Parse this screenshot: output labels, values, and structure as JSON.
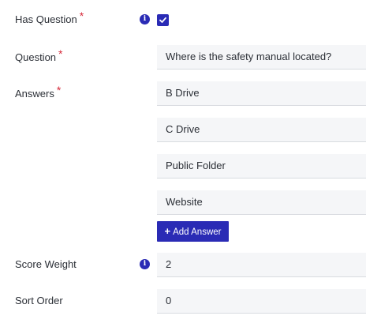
{
  "has_question": {
    "label": "Has Question",
    "required_mark": "*",
    "info_icon": "info-icon",
    "checked": true
  },
  "question": {
    "label": "Question",
    "required_mark": "*",
    "value": "Where is the safety manual located?"
  },
  "answers": {
    "label": "Answers",
    "required_mark": "*",
    "items": [
      "B Drive",
      "C Drive",
      "Public Folder",
      "Website"
    ],
    "add_label": "Add Answer",
    "add_icon": "plus-icon",
    "add_icon_glyph": "+"
  },
  "score_weight": {
    "label": "Score Weight",
    "info_icon": "info-icon",
    "value": "2"
  },
  "sort_order": {
    "label": "Sort Order",
    "value": "0"
  },
  "colors": {
    "accent": "#2a2bb5",
    "required": "#d62a3a",
    "field_bg": "#f5f6f8"
  }
}
